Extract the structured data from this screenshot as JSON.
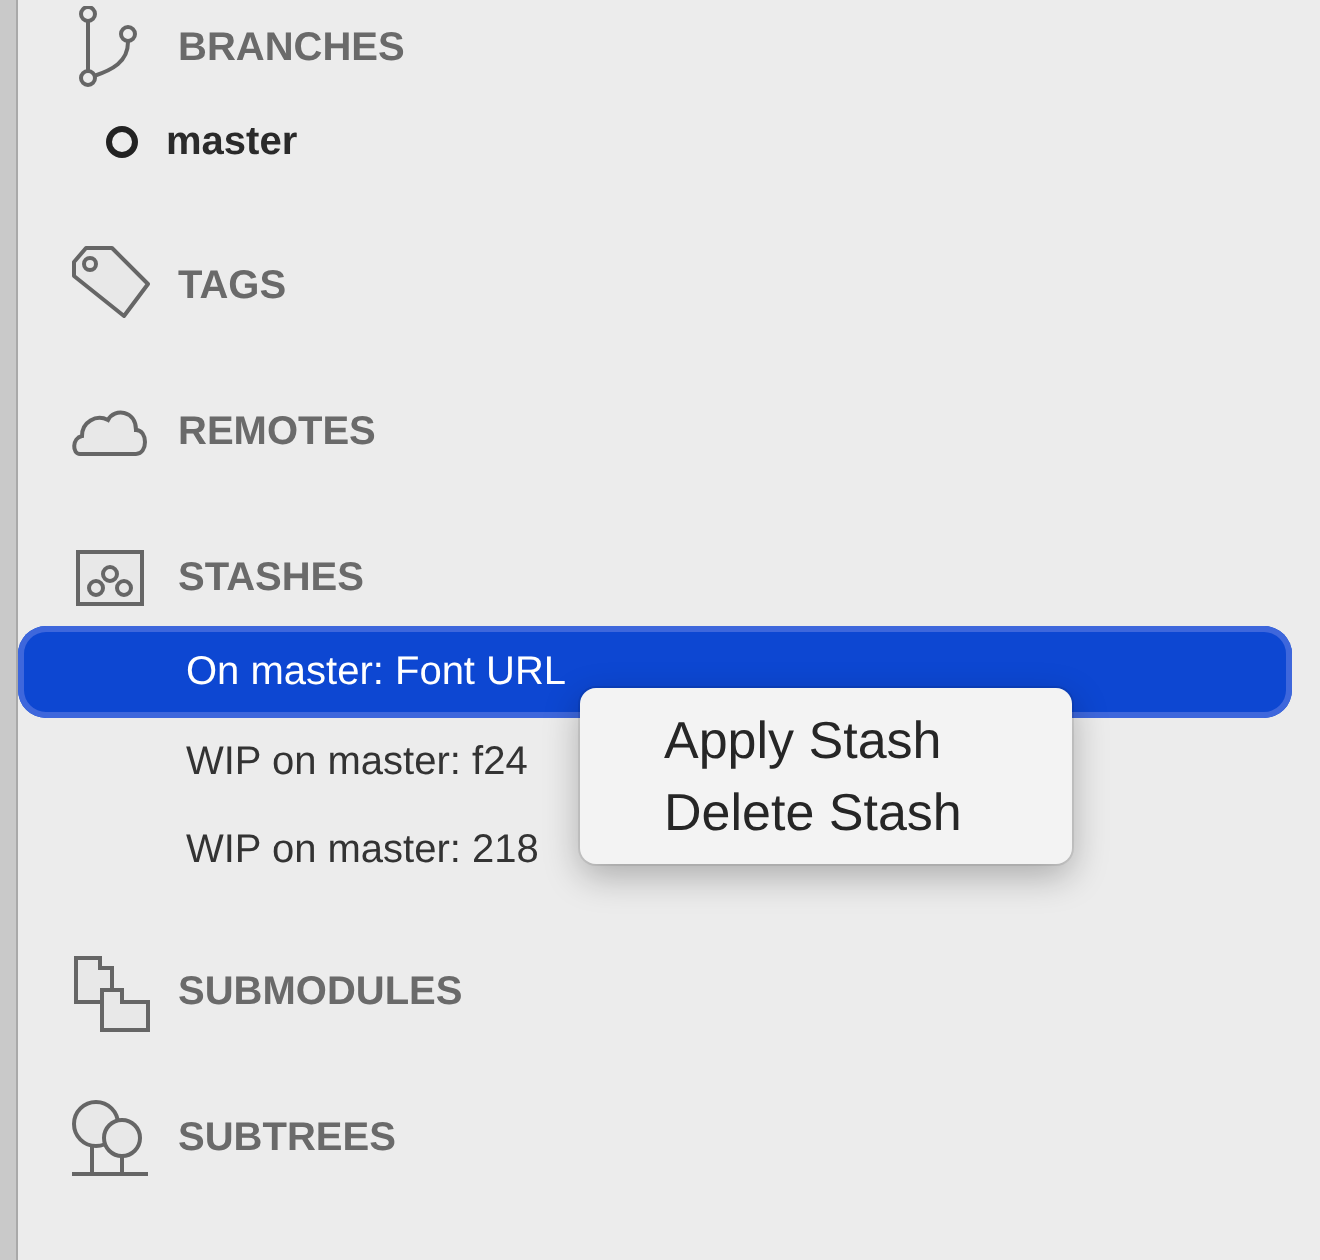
{
  "sections": [
    {
      "title": "BRANCHES",
      "kind": "branches",
      "items": [
        {
          "label": "master",
          "kind": "branch",
          "current": true
        }
      ]
    },
    {
      "title": "TAGS",
      "kind": "tags"
    },
    {
      "title": "REMOTES",
      "kind": "remotes"
    },
    {
      "title": "STASHES",
      "kind": "stashes",
      "items": [
        {
          "label": "On master: Font URL",
          "kind": "stash",
          "selected": true
        },
        {
          "label": "WIP on master: f24",
          "kind": "stash",
          "selected": false
        },
        {
          "label": "WIP on master: 218",
          "kind": "stash",
          "selected": false
        }
      ]
    },
    {
      "title": "SUBMODULES",
      "kind": "submodules"
    },
    {
      "title": "SUBTREES",
      "kind": "subtrees"
    }
  ],
  "context_menu": {
    "items": [
      "Apply Stash",
      "Delete Stash"
    ]
  }
}
